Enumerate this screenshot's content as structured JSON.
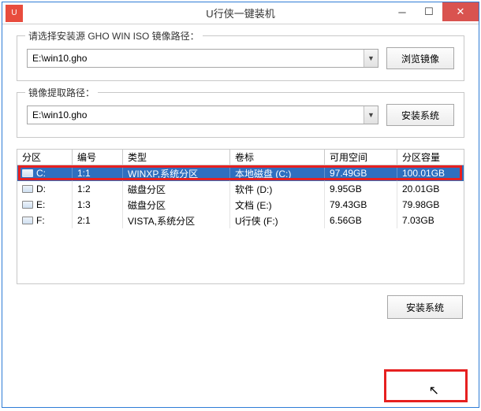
{
  "title": "U行侠一键装机",
  "group1": {
    "label": "请选择安装源 GHO WIN ISO 镜像路径：",
    "value": "E:\\win10.gho",
    "button": "浏览镜像"
  },
  "group2": {
    "label": "镜像提取路径：",
    "value": "E:\\win10.gho",
    "button": "安装系统"
  },
  "columns": [
    "分区",
    "编号",
    "类型",
    "卷标",
    "可用空间",
    "分区容量"
  ],
  "rows": [
    {
      "drive": "C:",
      "num": "1:1",
      "type": "WINXP,系统分区",
      "label": "本地磁盘 (C:)",
      "free": "97.49GB",
      "total": "100.01GB"
    },
    {
      "drive": "D:",
      "num": "1:2",
      "type": "磁盘分区",
      "label": "软件 (D:)",
      "free": "9.95GB",
      "total": "20.01GB"
    },
    {
      "drive": "E:",
      "num": "1:3",
      "type": "磁盘分区",
      "label": "文档 (E:)",
      "free": "79.43GB",
      "total": "79.98GB"
    },
    {
      "drive": "F:",
      "num": "2:1",
      "type": "VISTA,系统分区",
      "label": "U行侠 (F:)",
      "free": "6.56GB",
      "total": "7.03GB"
    }
  ],
  "install_btn": "安装系统"
}
